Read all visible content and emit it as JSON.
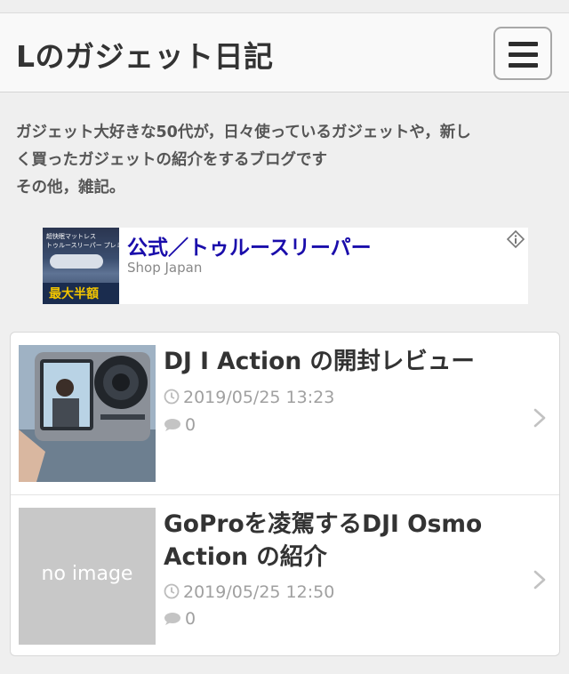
{
  "header": {
    "site_title": "Lのガジェット日記",
    "menu_icon": "hamburger-icon"
  },
  "description": {
    "line1": "ガジェット大好きな50代が，日々使っているガジェットや，新し",
    "line2": "く買ったガジェットの紹介をするブログです",
    "line3": "その他，雑記。"
  },
  "ad": {
    "image_line1": "超快眠マットレス",
    "image_line2": "トゥルースリーパー プレミアケア",
    "image_banner": "最大半額",
    "title": "公式／トゥルースリーパー",
    "subtitle": "Shop Japan",
    "info_icon": "ad-info-icon"
  },
  "posts": [
    {
      "title": "DJ I Action の開封レビュー",
      "date": "2019/05/25 13:23",
      "comments": "0",
      "thumbnail": "camera-photo"
    },
    {
      "title": "GoProを凌駕するDJI Osmo Action の紹介",
      "title_line1": "GoProを凌駕するDJI Osmo",
      "title_line2": "Action の紹介",
      "date": "2019/05/25 12:50",
      "comments": "0",
      "thumbnail_text": "no image"
    }
  ],
  "colors": {
    "background": "#efefef",
    "ad_link": "#1a0dab",
    "meta_gray": "#a0a0a0"
  }
}
